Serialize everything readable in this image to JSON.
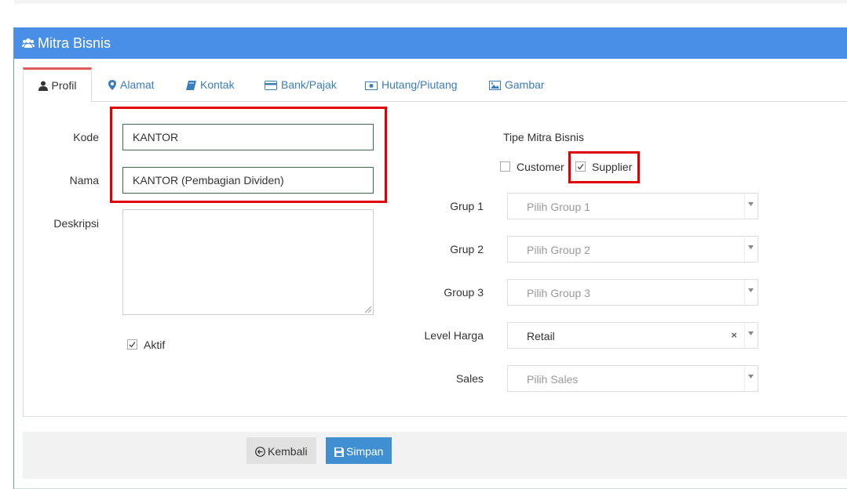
{
  "panel": {
    "title": "Mitra Bisnis"
  },
  "tabs": [
    {
      "label": "Profil",
      "icon": "user-icon"
    },
    {
      "label": "Alamat",
      "icon": "map-marker-icon"
    },
    {
      "label": "Kontak",
      "icon": "book-icon"
    },
    {
      "label": "Bank/Pajak",
      "icon": "credit-card-icon"
    },
    {
      "label": "Hutang/Piutang",
      "icon": "money-icon"
    },
    {
      "label": "Gambar",
      "icon": "image-icon"
    }
  ],
  "form": {
    "kode_label": "Kode",
    "kode_value": "KANTOR",
    "nama_label": "Nama",
    "nama_value": "KANTOR (Pembagian Dividen)",
    "deskripsi_label": "Deskripsi",
    "deskripsi_value": "",
    "aktif_label": "Aktif",
    "aktif_checked": true,
    "tipe_label": "Tipe Mitra Bisnis",
    "customer_label": "Customer",
    "customer_checked": false,
    "supplier_label": "Supplier",
    "supplier_checked": true,
    "group1_label": "Grup 1",
    "group1_placeholder": "Pilih Group 1",
    "group2_label": "Grup 2",
    "group2_placeholder": "Pilih Group 2",
    "group3_label": "Group 3",
    "group3_placeholder": "Pilih Group 3",
    "level_harga_label": "Level Harga",
    "level_harga_value": "Retail",
    "sales_label": "Sales",
    "sales_placeholder": "Pilih Sales"
  },
  "buttons": {
    "back": "Kembali",
    "save": "Simpan"
  },
  "colors": {
    "header": "#4a8fe7",
    "highlight": "#e00000",
    "primary": "#3f8fd2"
  }
}
